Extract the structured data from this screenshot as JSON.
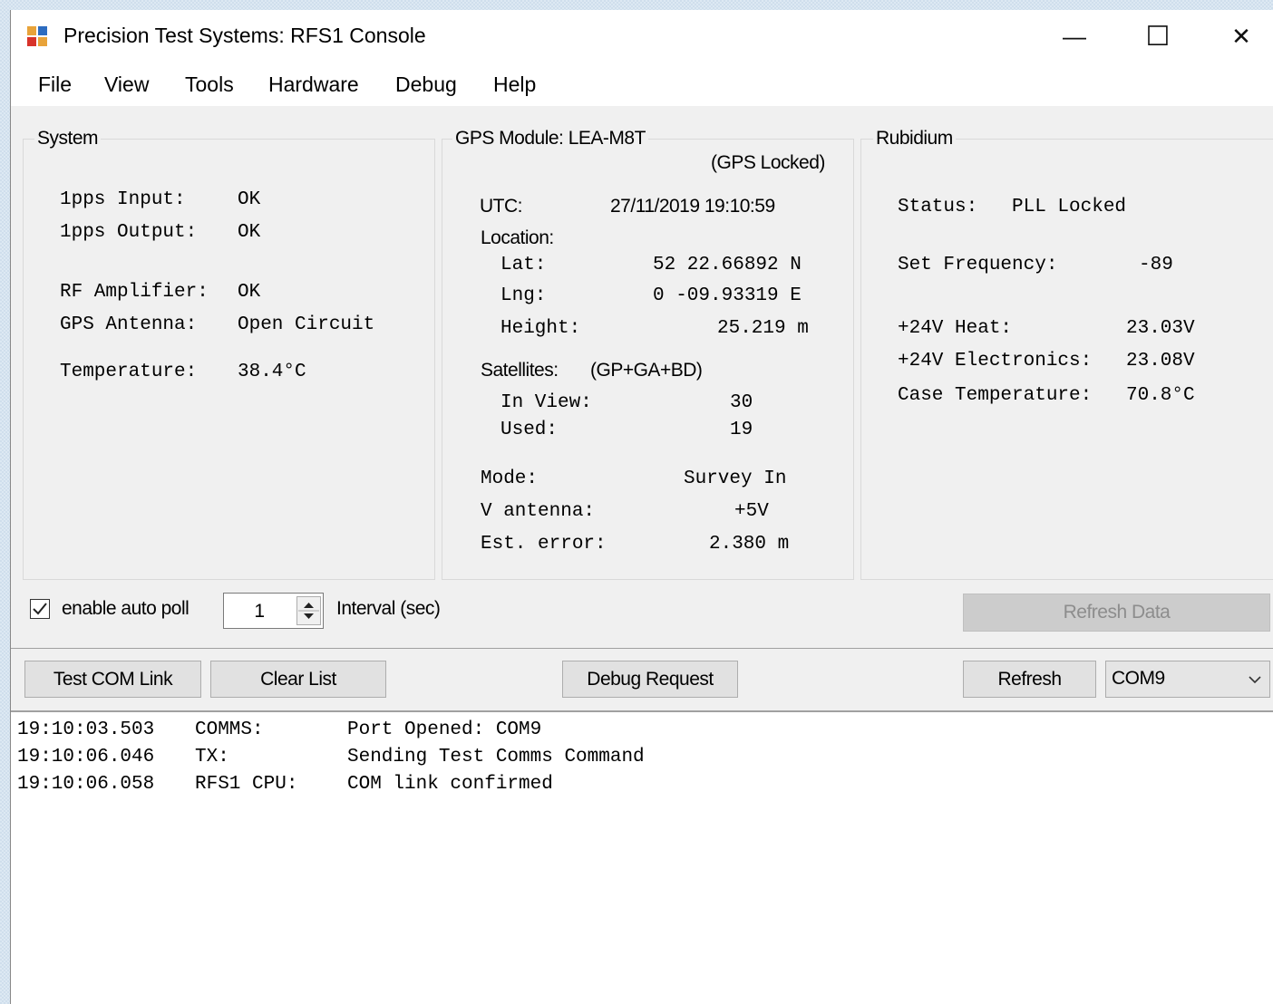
{
  "window": {
    "title": "Precision Test Systems: RFS1 Console",
    "controls": {
      "minimize": "—",
      "maximize": "☐",
      "close": "✕"
    }
  },
  "menu": [
    "File",
    "View",
    "Tools",
    "Hardware",
    "Debug",
    "Help"
  ],
  "system": {
    "title": "System",
    "rows": [
      {
        "label": "1pps Input:",
        "value": "OK"
      },
      {
        "label": "1pps Output:",
        "value": "OK"
      },
      {
        "label": "RF Amplifier:",
        "value": "OK"
      },
      {
        "label": "GPS Antenna:",
        "value": "Open Circuit"
      },
      {
        "label": "Temperature:",
        "value": "38.4°C"
      }
    ]
  },
  "gps": {
    "title": "GPS Module: LEA-M8T",
    "lock_status": "(GPS Locked)",
    "utc_label": "UTC:",
    "utc_value": "27/11/2019 19:10:59",
    "location_label": "Location:",
    "lat_label": "Lat:",
    "lat_value": "52 22.66892 N",
    "lng_label": "Lng:",
    "lng_value": "0 -09.93319 E",
    "height_label": "Height:",
    "height_value": "25.219 m",
    "satellites_label": "Satellites:",
    "satellites_systems": "(GP+GA+BD)",
    "inview_label": "In View:",
    "inview_value": "30",
    "used_label": "Used:",
    "used_value": "19",
    "mode_label": "Mode:",
    "mode_value": "Survey In",
    "vant_label": "V antenna:",
    "vant_value": "+5V",
    "esterr_label": "Est. error:",
    "esterr_value": "2.380 m"
  },
  "rubidium": {
    "title": "Rubidium",
    "status_label": "Status:",
    "status_value": "PLL Locked",
    "setfreq_label": "Set Frequency:",
    "setfreq_value": "-89",
    "heat_label": "+24V Heat:",
    "heat_value": "23.03V",
    "elec_label": "+24V Electronics:",
    "elec_value": "23.08V",
    "casetemp_label": "Case Temperature:",
    "casetemp_value": "70.8°C"
  },
  "poll": {
    "enable_label": "enable auto poll",
    "enabled": true,
    "interval_value": "1",
    "interval_label": "Interval (sec)",
    "refresh_data_label": "Refresh Data"
  },
  "toolbar": {
    "test_com_label": "Test COM Link",
    "clear_list_label": "Clear List",
    "debug_request_label": "Debug Request",
    "refresh_label": "Refresh",
    "com_port": "COM9"
  },
  "log": [
    {
      "time": "19:10:03.503",
      "source": "COMMS:",
      "message": "Port Opened: COM9"
    },
    {
      "time": "19:10:06.046",
      "source": "TX:",
      "message": "Sending Test Comms Command"
    },
    {
      "time": "19:10:06.058",
      "source": "RFS1 CPU:",
      "message": "COM link confirmed"
    }
  ],
  "colors": {
    "window_bg": "#f0f0f0",
    "disabled_button": "#cccccc"
  }
}
